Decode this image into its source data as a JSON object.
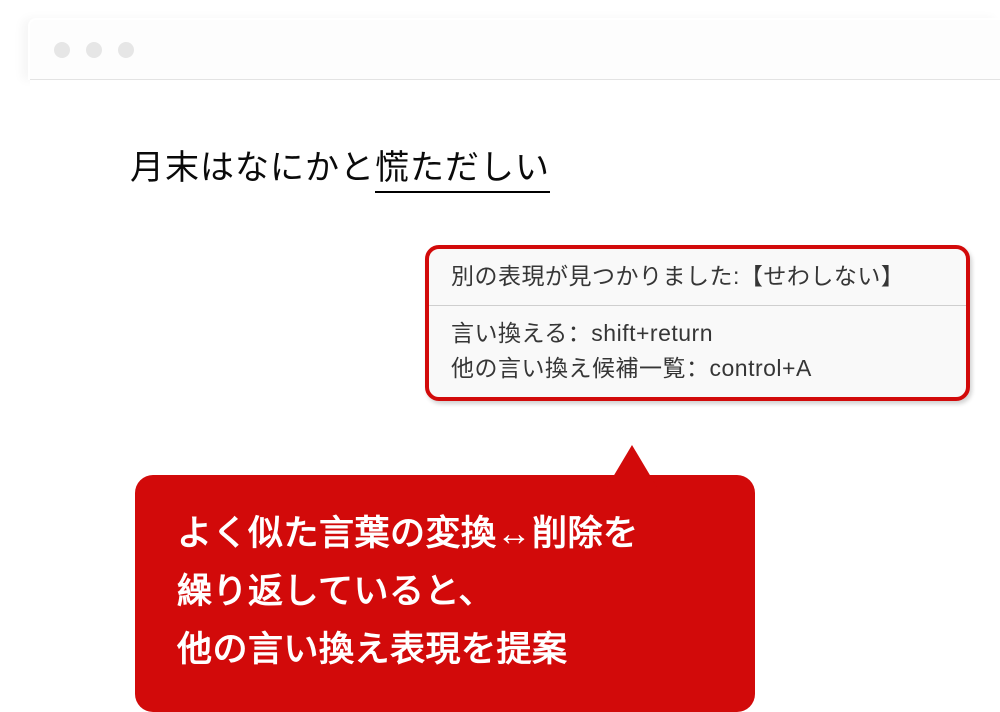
{
  "editor": {
    "text_before": "月末はなにかと",
    "text_highlight": "慌ただしい"
  },
  "popup": {
    "found_label": "別の表現が見つかりました:【せわしない】",
    "replace_label": "言い換える：shift+return",
    "list_label": "他の言い換え候補一覧：control+A"
  },
  "callout": {
    "line1": "よく似た言葉の変換↔削除を",
    "line2": "繰り返していると、",
    "line3": "他の言い換え表現を提案"
  }
}
